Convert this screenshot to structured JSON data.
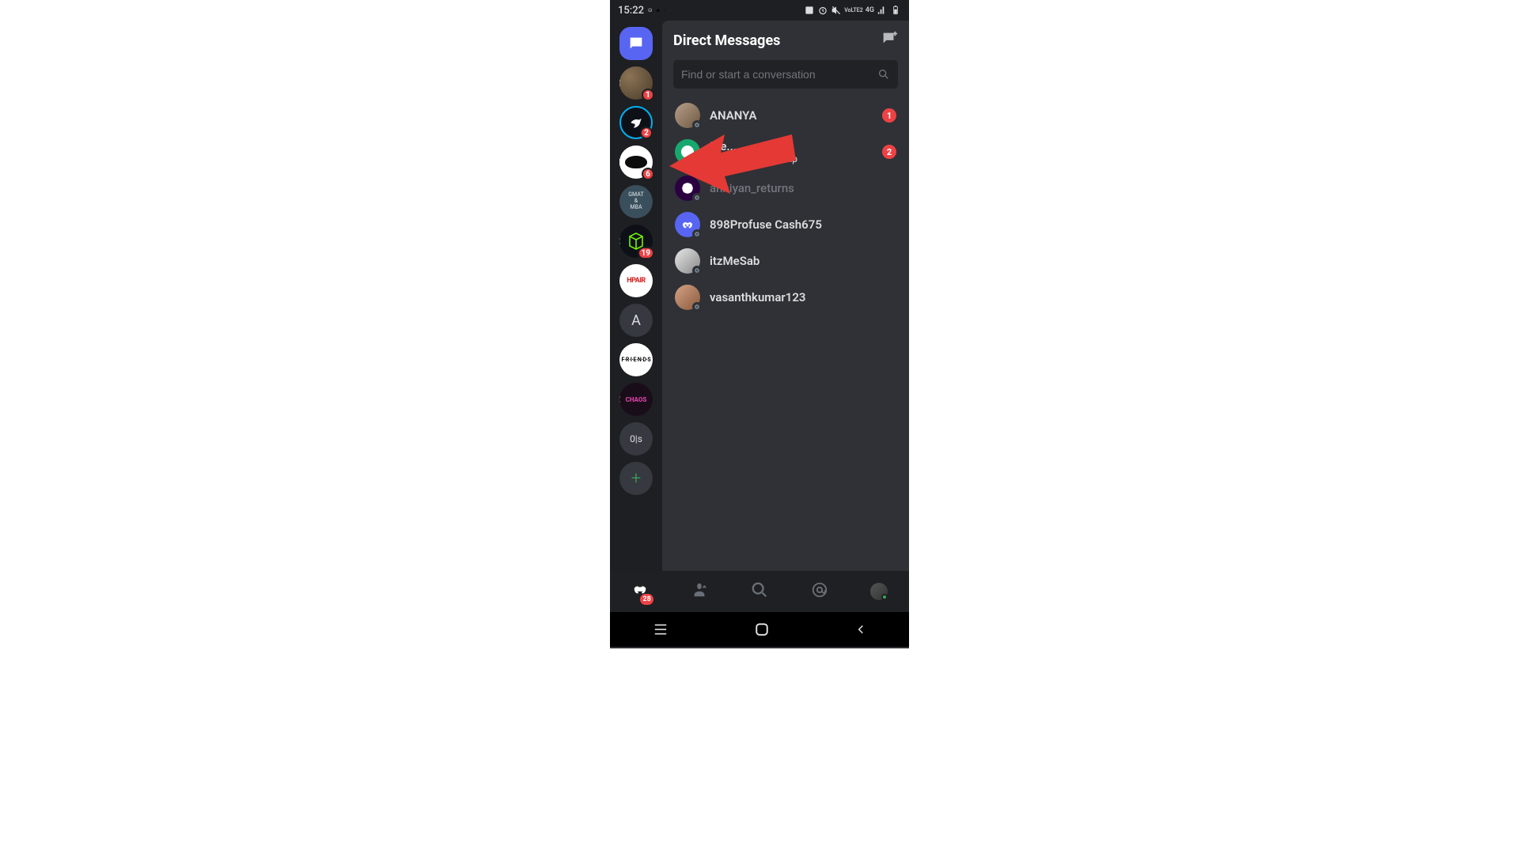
{
  "status": {
    "time": "15:22",
    "network": "4G",
    "volte": "VoLTE2"
  },
  "header": {
    "title": "Direct Messages"
  },
  "search": {
    "placeholder": "Find or start a conversation"
  },
  "servers": [
    {
      "id": "dm",
      "type": "dm"
    },
    {
      "id": "s1",
      "type": "avatar1",
      "badge": "1"
    },
    {
      "id": "s2",
      "type": "avatar2",
      "badge": "2"
    },
    {
      "id": "s3",
      "type": "ninja",
      "badge": "6"
    },
    {
      "id": "s4",
      "type": "gmat",
      "label": "GMAT\n&\nMBA"
    },
    {
      "id": "s5",
      "type": "cube",
      "badge": "19"
    },
    {
      "id": "s6",
      "type": "hpair",
      "label": "HPAIR"
    },
    {
      "id": "s7",
      "type": "letter-a",
      "label": "A"
    },
    {
      "id": "s8",
      "type": "friends",
      "label": "F·R·I·E·N·D·S"
    },
    {
      "id": "s9",
      "type": "chaos",
      "label": "CHAOS"
    },
    {
      "id": "s10",
      "type": "ols",
      "label": "0|s"
    },
    {
      "id": "add",
      "type": "add",
      "label": "+"
    }
  ],
  "dms": [
    {
      "name": "ANANYA",
      "badge": "1",
      "dim": false,
      "avatar": "ananya",
      "status": "offline"
    },
    {
      "name": "Fre...",
      "activity_pre": "Playing ",
      "activity_hi": "music | ;;help",
      "badge": "2",
      "dim": false,
      "avatar": "fred",
      "status": "online"
    },
    {
      "name": "anniyan_returns",
      "dim": true,
      "avatar": "anniyan",
      "status": "offline"
    },
    {
      "name": "898Profuse Cash675",
      "dim": false,
      "avatar": "cash",
      "status": "offline"
    },
    {
      "name": "itzMeSab",
      "dim": false,
      "avatar": "itz",
      "status": "offline"
    },
    {
      "name": "vasanthkumar123",
      "dim": false,
      "avatar": "vasanth",
      "status": "offline"
    }
  ],
  "tabs": {
    "home_badge": "28"
  }
}
